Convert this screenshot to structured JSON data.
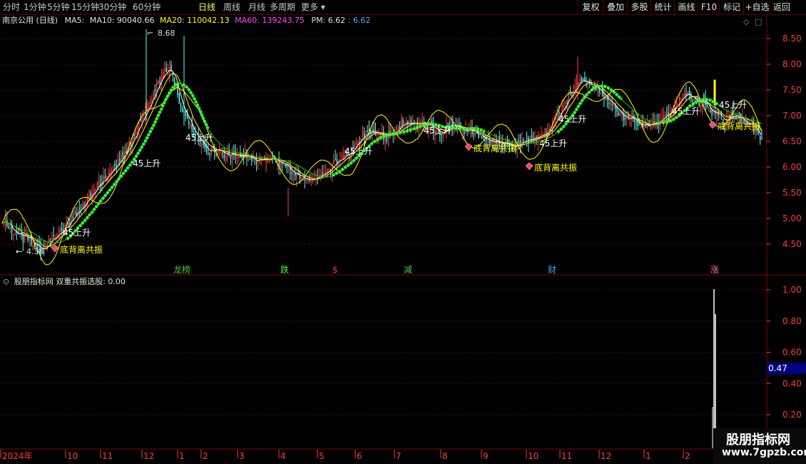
{
  "toolbar": {
    "periods": [
      "分时",
      "1分钟",
      "5分钟",
      "15分钟",
      "30分钟",
      "60分钟",
      "日线",
      "周线",
      "月线",
      "多周期",
      "更多"
    ],
    "active_period": "日线",
    "right_buttons": [
      "复权",
      "叠加",
      "多股",
      "统计",
      "画线",
      "F10",
      "标记",
      "+自选",
      "返回"
    ]
  },
  "main_header": {
    "stock": "南京公用 (日线)",
    "ma5": "MA5:",
    "ma10": "MA10: 90040.66",
    "ma20": "MA20: 110042.13",
    "ma60": "MA60: 139243.75",
    "pm_label": "PM: 6.62",
    "pm_value": ": 6.62"
  },
  "sub_header": {
    "label": "股朋指标网  双重共振选股: 0.00"
  },
  "colors": {
    "up": "#ff3c3c",
    "down": "#54ffff",
    "ma_yellow": "#ffff00",
    "ma_white": "#ffffff",
    "ma_green": "#00cc00",
    "trend_green": "#33ff33",
    "grid_red": "#7a0000",
    "axis_red": "#ff3c3c"
  },
  "price_axis": {
    "ticks": [
      "8.50",
      "8.00",
      "7.50",
      "7.00",
      "6.50",
      "6.00",
      "5.50",
      "5.00",
      "4.50"
    ],
    "values": [
      8.5,
      8.0,
      7.5,
      7.0,
      6.5,
      6.0,
      5.5,
      5.0,
      4.5
    ],
    "high_label": "8.68",
    "low_label": "4.38"
  },
  "sub_axis": {
    "ticks": [
      "1.00",
      "0.80",
      "0.60",
      "0.40",
      "0.20"
    ],
    "values": [
      1.0,
      0.8,
      0.6,
      0.4,
      0.2
    ],
    "current": "0.47"
  },
  "date_axis": {
    "labels": [
      "2024年",
      "10",
      "11",
      "12",
      "1",
      "2",
      "3",
      "4",
      "5",
      "6",
      "7",
      "8",
      "9",
      "10",
      "11",
      "12",
      "1",
      "2"
    ]
  },
  "signals": {
    "rise_label": "45上升",
    "resonance_label": "底背离共振"
  },
  "event_markers": [
    "龙榜",
    "跌",
    "$",
    "减",
    "财",
    "涨"
  ],
  "watermark": {
    "title": "股朋指标网",
    "url": "www.7gpzb.com"
  },
  "chart_data": {
    "type": "candlestick",
    "title": "南京公用 (日线)",
    "ylim": [
      4.2,
      8.9
    ],
    "close_path": [
      [
        0,
        4.95
      ],
      [
        8,
        4.75
      ],
      [
        16,
        4.6
      ],
      [
        24,
        4.38
      ],
      [
        32,
        4.6
      ],
      [
        40,
        4.9
      ],
      [
        48,
        5.2
      ],
      [
        56,
        5.5
      ],
      [
        64,
        5.8
      ],
      [
        72,
        6.1
      ],
      [
        80,
        6.5
      ],
      [
        88,
        7.0
      ],
      [
        96,
        7.6
      ],
      [
        104,
        8.0
      ],
      [
        112,
        7.1
      ],
      [
        120,
        6.6
      ],
      [
        128,
        6.3
      ],
      [
        136,
        6.3
      ],
      [
        144,
        6.2
      ],
      [
        152,
        6.2
      ],
      [
        160,
        6.1
      ],
      [
        168,
        6.2
      ],
      [
        176,
        6.0
      ],
      [
        184,
        5.8
      ],
      [
        192,
        5.7
      ],
      [
        200,
        5.9
      ],
      [
        208,
        6.1
      ],
      [
        216,
        6.3
      ],
      [
        224,
        6.6
      ],
      [
        232,
        6.7
      ],
      [
        240,
        6.6
      ],
      [
        248,
        6.8
      ],
      [
        256,
        6.9
      ],
      [
        264,
        6.85
      ],
      [
        272,
        6.7
      ],
      [
        280,
        6.8
      ],
      [
        288,
        6.75
      ],
      [
        296,
        6.6
      ],
      [
        304,
        6.5
      ],
      [
        312,
        6.45
      ],
      [
        320,
        6.4
      ],
      [
        328,
        6.55
      ],
      [
        336,
        6.6
      ],
      [
        344,
        6.9
      ],
      [
        352,
        7.4
      ],
      [
        360,
        7.7
      ],
      [
        368,
        7.6
      ],
      [
        376,
        7.3
      ],
      [
        384,
        7.0
      ],
      [
        392,
        6.9
      ],
      [
        400,
        6.8
      ],
      [
        408,
        6.9
      ],
      [
        416,
        7.1
      ],
      [
        424,
        7.4
      ],
      [
        432,
        7.3
      ],
      [
        440,
        7.1
      ],
      [
        448,
        6.9
      ],
      [
        456,
        7.0
      ],
      [
        464,
        6.8
      ],
      [
        472,
        6.6
      ]
    ]
  }
}
